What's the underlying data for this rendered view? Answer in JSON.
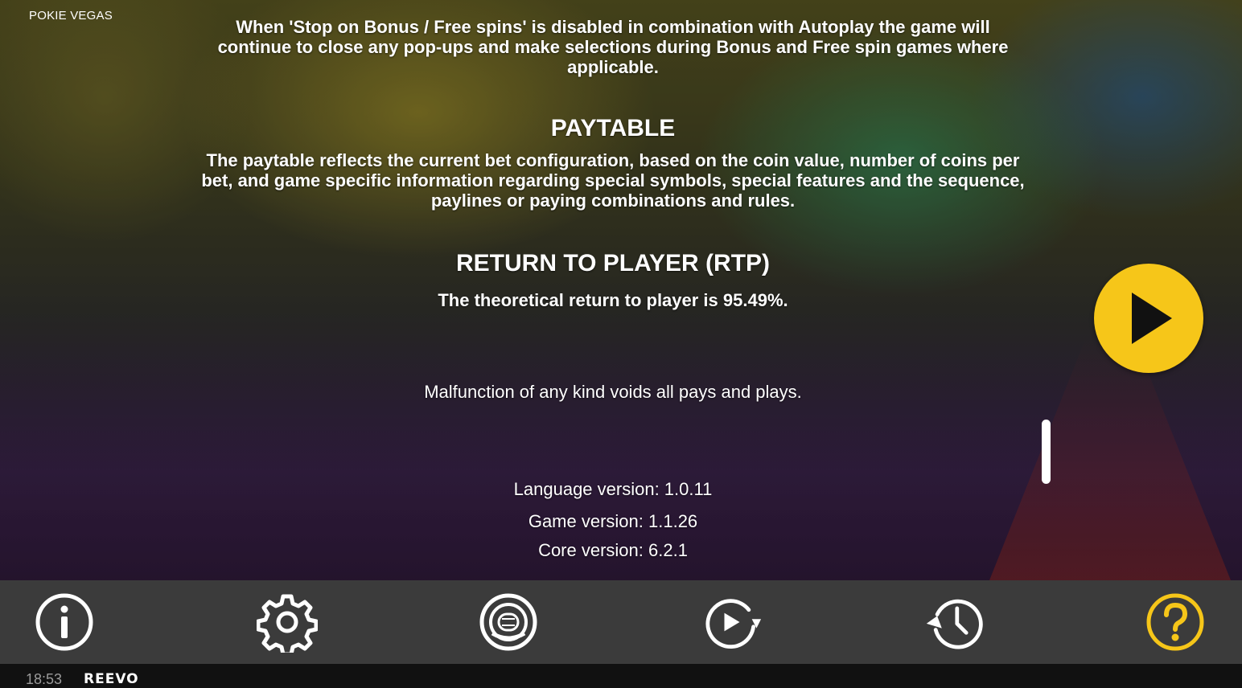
{
  "header": {
    "game_title": "POKIE VEGAS"
  },
  "content": {
    "autoplay_note": "When 'Stop on Bonus / Free spins' is disabled in combination with Autoplay the game will continue to close any pop-ups and make selections during Bonus and Free spin games where applicable.",
    "paytable_heading": "PAYTABLE",
    "paytable_text": "The paytable reflects the current bet configuration, based on the coin value, number of coins per bet, and game specific information regarding special symbols, special features and the sequence, paylines or paying combinations and rules.",
    "rtp_heading": "RETURN TO PLAYER (RTP)",
    "rtp_text": "The theoretical return to player is 95.49%.",
    "malfunction_text": "Malfunction of any kind voids all pays and plays.",
    "language_version": "Language version: 1.0.11",
    "game_version": "Game version: 1.1.26",
    "core_version": "Core version: 6.2.1"
  },
  "play_button": {
    "icon": "play-icon",
    "color": "#f6c619"
  },
  "toolbar": {
    "buttons": [
      {
        "id": "info",
        "icon": "info-icon"
      },
      {
        "id": "settings",
        "icon": "gear-icon"
      },
      {
        "id": "bet",
        "icon": "chip-icon"
      },
      {
        "id": "autoplay",
        "icon": "autoplay-icon"
      },
      {
        "id": "history",
        "icon": "history-icon"
      },
      {
        "id": "help",
        "icon": "help-icon",
        "active": true,
        "color": "#f6c619"
      }
    ]
  },
  "status": {
    "time": "18:53",
    "brand": "REEVO"
  }
}
